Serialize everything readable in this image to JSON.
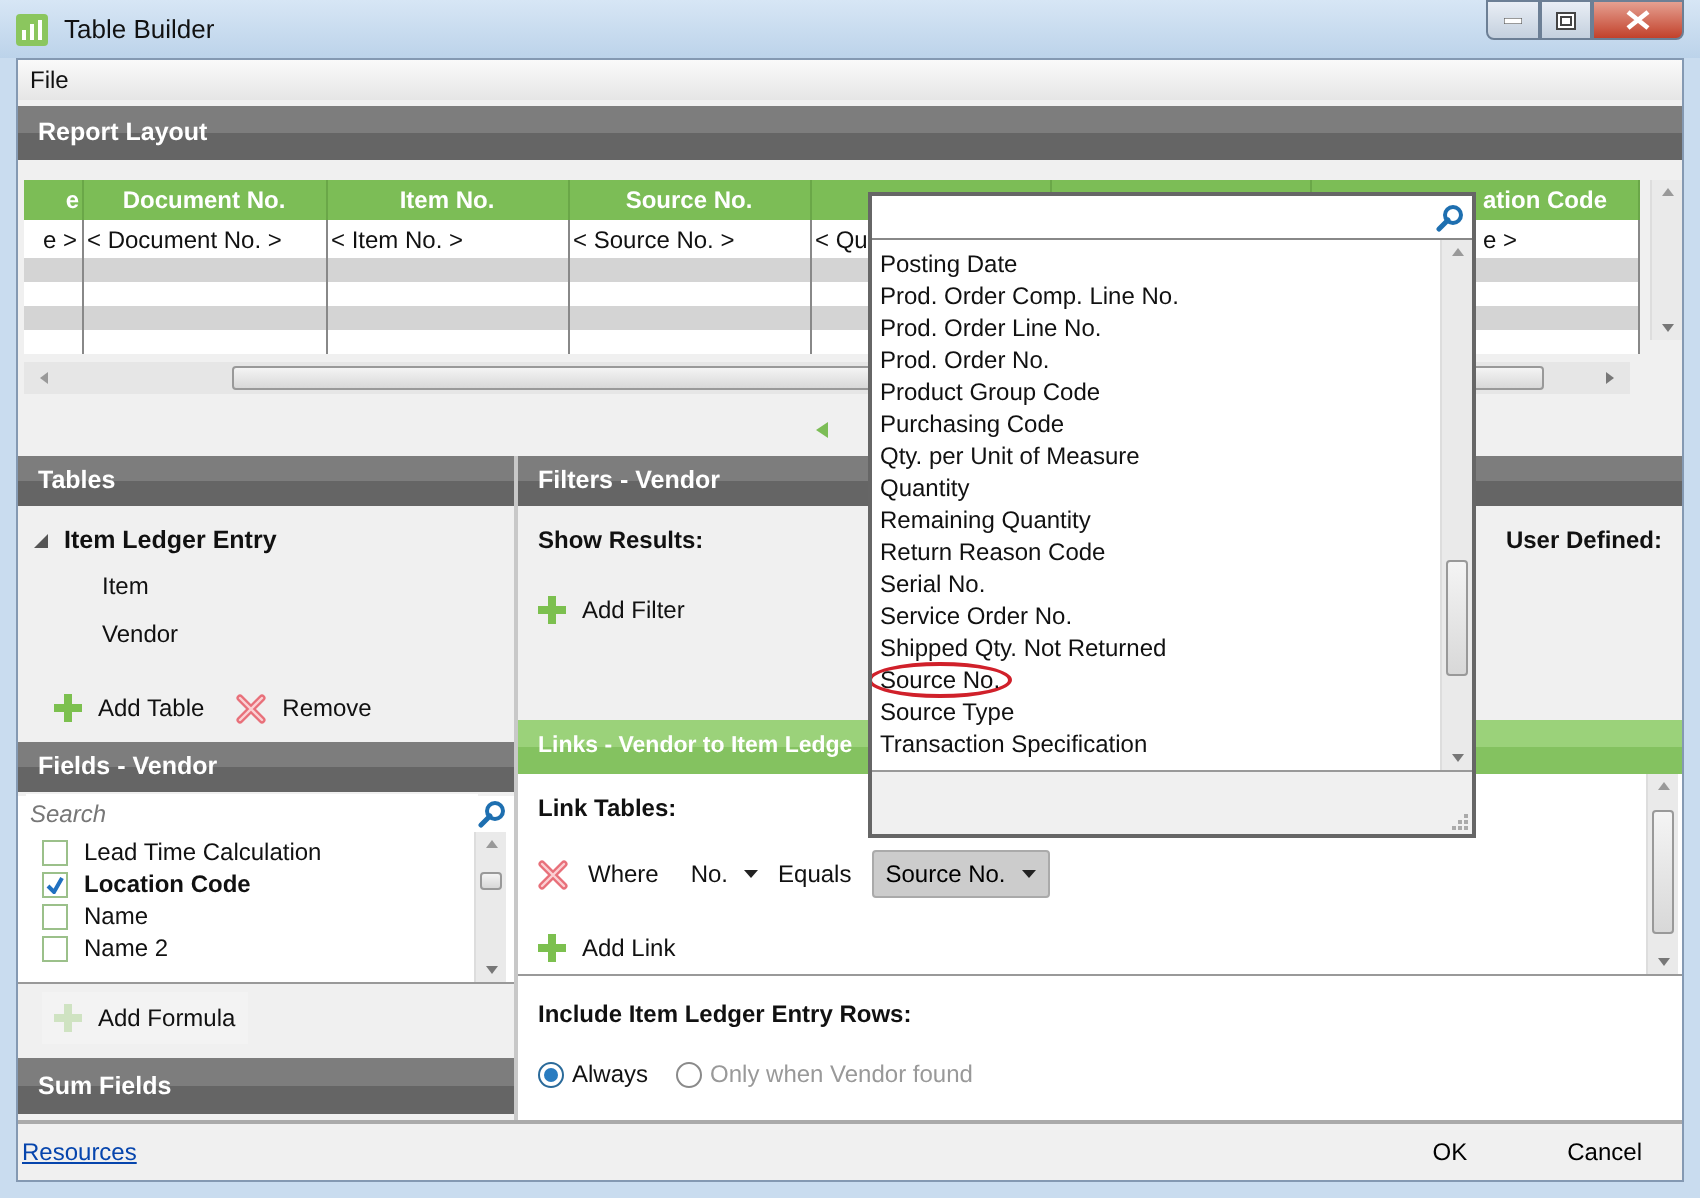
{
  "window": {
    "title": "Table Builder"
  },
  "menu": [
    {
      "label": "File"
    }
  ],
  "report_layout": {
    "title": "Report Layout",
    "columns": [
      {
        "header": "e",
        "cell": "e >"
      },
      {
        "header": "Document No.",
        "cell": "< Document No. >"
      },
      {
        "header": "Item No.",
        "cell": "< Item No. >"
      },
      {
        "header": "Source No.",
        "cell": "< Source No. >"
      },
      {
        "cell": "< Qu"
      },
      {},
      {
        "header": "ation Code",
        "cell": "e >"
      }
    ]
  },
  "tables_panel": {
    "title": "Tables",
    "tree": [
      {
        "label": "Item Ledger Entry",
        "expanded": true,
        "children": [
          {
            "label": "Item"
          },
          {
            "label": "Vendor"
          }
        ]
      }
    ],
    "actions": [
      {
        "label": "Add Table",
        "kind": "add"
      },
      {
        "label": "Remove",
        "kind": "remove"
      }
    ]
  },
  "fields_panel": {
    "title": "Fields - Vendor",
    "search": {
      "placeholder": "Search"
    },
    "fields": [
      {
        "label": "Lead Time Calculation",
        "checked": false
      },
      {
        "label": "Location Code",
        "checked": true
      },
      {
        "label": "Name",
        "checked": false
      },
      {
        "label": "Name 2",
        "checked": false
      }
    ],
    "add_formula": {
      "label": "Add Formula",
      "disabled": true
    }
  },
  "sum_fields_panel": {
    "title": "Sum Fields"
  },
  "filters_panel": {
    "title": "Filters - Vendor",
    "show_results": "Show Results:",
    "user_defined": "User Defined:",
    "add_filter": "Add Filter"
  },
  "links_panel": {
    "title": "Links - Vendor to Item Ledge",
    "link_tables": "Link Tables:",
    "link": {
      "where": "Where",
      "field": "No.",
      "equals": "Equals",
      "target": "Source No."
    },
    "add_link": "Add Link"
  },
  "include_rows": {
    "label": "Include Item Ledger Entry Rows:",
    "options": [
      {
        "label": "Always",
        "selected": true,
        "disabled": false
      },
      {
        "label": "Only when Vendor found",
        "selected": false,
        "disabled": true
      }
    ]
  },
  "dropdown": {
    "items": [
      {
        "label": "Posting Date",
        "circled": false
      },
      {
        "label": "Prod. Order Comp. Line No.",
        "circled": false
      },
      {
        "label": "Prod. Order Line No.",
        "circled": false
      },
      {
        "label": "Prod. Order No.",
        "circled": false
      },
      {
        "label": "Product Group Code",
        "circled": false
      },
      {
        "label": "Purchasing Code",
        "circled": false
      },
      {
        "label": "Qty. per Unit of Measure",
        "circled": false
      },
      {
        "label": "Quantity",
        "circled": false
      },
      {
        "label": "Remaining Quantity",
        "circled": false
      },
      {
        "label": "Return Reason Code",
        "circled": false
      },
      {
        "label": "Serial No.",
        "circled": false
      },
      {
        "label": "Service Order No.",
        "circled": false
      },
      {
        "label": "Shipped Qty. Not Returned",
        "circled": false
      },
      {
        "label": "Source No.",
        "circled": true
      },
      {
        "label": "Source Type",
        "circled": false
      },
      {
        "label": "Transaction Specification",
        "circled": false
      }
    ]
  },
  "footer": {
    "link": "Resources",
    "buttons": [
      {
        "label": "OK"
      },
      {
        "label": "Cancel"
      }
    ]
  }
}
